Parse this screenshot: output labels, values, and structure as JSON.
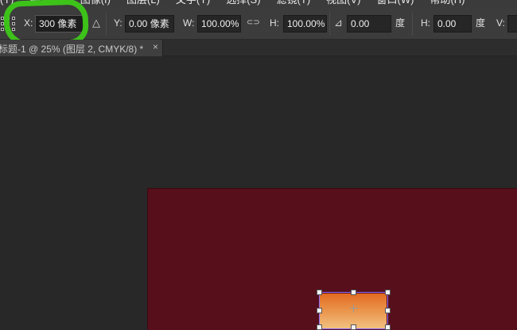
{
  "menu": {
    "items": [
      "(Y)",
      "编辑(E)",
      "图像(I)",
      "图层(L)",
      "文字(Y)",
      "选择(S)",
      "滤镜(T)",
      "视图(V)",
      "窗口(W)",
      "帮助(H)"
    ]
  },
  "options_bar": {
    "x_label": "X:",
    "x_value": "300 像素",
    "delta_icon": "triangle-icon",
    "delta_glyph": "△",
    "y_label": "Y:",
    "y_value": "0.00 像素",
    "w_label": "W:",
    "w_value": "100.00%",
    "link_icon": "link-icon",
    "link_glyph": "⊂⊃",
    "h_label": "H:",
    "h_value": "100.00%",
    "angle_icon": "angle-icon",
    "angle_glyph": "⊿",
    "angle_value": "0.00",
    "angle_unit": "度",
    "hskew_label": "H:",
    "hskew_value": "0.00",
    "hskew_unit": "度",
    "vskew_label": "V:"
  },
  "document_tab": {
    "title": "标题-1 @ 25% (图层 2, CMYK/8) *",
    "close_glyph": "×"
  },
  "colors": {
    "highlight": "#3dc21a",
    "document_bg": "#560f1b",
    "layer_top": "#e26a20",
    "layer_bottom": "#f1c081",
    "bbox": "#8a6cff"
  }
}
